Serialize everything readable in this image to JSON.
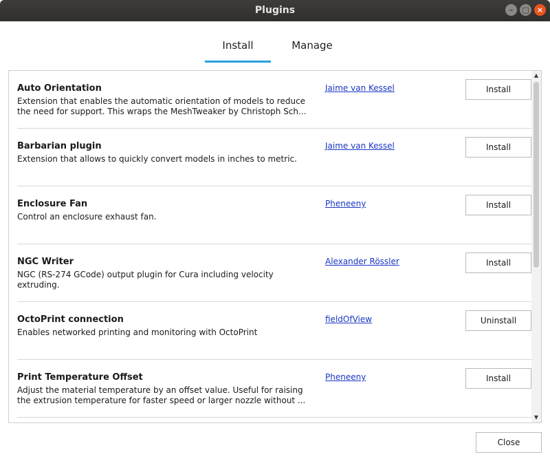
{
  "window": {
    "title": "Plugins",
    "controls": {
      "minimize_glyph": "–",
      "maximize_glyph": "□",
      "close_glyph": "×"
    }
  },
  "tabs": [
    {
      "label": "Install",
      "active": true
    },
    {
      "label": "Manage",
      "active": false
    }
  ],
  "plugins": [
    {
      "name": "Auto Orientation",
      "description": "Extension that enables the automatic orientation of models to reduce\nthe need for support. This wraps the MeshTweaker by Christoph Sch...",
      "author": "Jaime van Kessel",
      "action": "Install"
    },
    {
      "name": "Barbarian plugin",
      "description": "Extension that allows to quickly convert models in inches to metric.",
      "author": "Jaime van Kessel",
      "action": "Install"
    },
    {
      "name": "Enclosure Fan",
      "description": "Control an enclosure exhaust fan.",
      "author": "Pheneeny",
      "action": "Install"
    },
    {
      "name": "NGC Writer",
      "description": "NGC (RS-274 GCode) output plugin for Cura including velocity\nextruding.",
      "author": "Alexander Rössler",
      "action": "Install"
    },
    {
      "name": "OctoPrint connection",
      "description": "Enables networked printing and monitoring with OctoPrint",
      "author": "fieldOfView",
      "action": "Uninstall"
    },
    {
      "name": "Print Temperature Offset",
      "description": "Adjust the material temperature by an offset value. Useful for raising\nthe extrusion temperature for faster speed or larger nozzle without ...",
      "author": "Pheneeny",
      "action": "Install"
    }
  ],
  "scrollbar": {
    "up_glyph": "▲",
    "down_glyph": "▼"
  },
  "footer": {
    "close_label": "Close"
  },
  "colors": {
    "accent": "#26a0da",
    "link": "#1a36c4",
    "titlebar": "#3d3c39",
    "close_control": "#e95420"
  }
}
